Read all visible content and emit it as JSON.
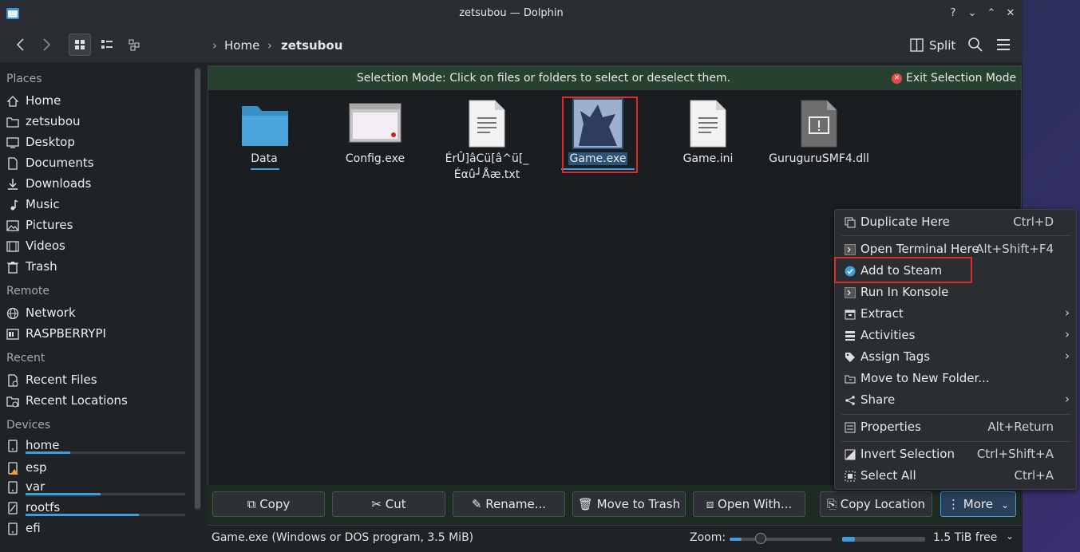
{
  "window": {
    "title": "zetsubou — Dolphin"
  },
  "title_buttons": [
    "?",
    "⌄",
    "⌃",
    "✕"
  ],
  "breadcrumb": {
    "home": "Home",
    "current": "zetsubou"
  },
  "toolbar": {
    "split_label": "Split"
  },
  "sidebar": {
    "places_heading": "Places",
    "places": [
      "Home",
      "zetsubou",
      "Desktop",
      "Documents",
      "Downloads",
      "Music",
      "Pictures",
      "Videos",
      "Trash"
    ],
    "remote_heading": "Remote",
    "remote": [
      "Network",
      "RASPBERRYPI"
    ],
    "recent_heading": "Recent",
    "recent": [
      "Recent Files",
      "Recent Locations"
    ],
    "devices_heading": "Devices",
    "devices": [
      {
        "label": "home",
        "usage": 0.28
      },
      {
        "label": "esp",
        "usage": 0.0
      },
      {
        "label": "var",
        "usage": 0.47
      },
      {
        "label": "rootfs",
        "usage": 0.71
      },
      {
        "label": "efi",
        "usage": 0.0
      }
    ]
  },
  "selection_bar": {
    "message": "Selection Mode: Click on files or folders to select or deselect them.",
    "exit_label": "Exit Selection Mode"
  },
  "files": [
    {
      "name": "Data",
      "icon": "folder-icon"
    },
    {
      "name": "Config.exe",
      "icon": "window-exe-icon"
    },
    {
      "name_line1": "ÉrÛ]âCü[â^ü[_",
      "name_line2": "Éαû┘Åæ.txt",
      "icon": "text-file-icon"
    },
    {
      "name": "Game.exe",
      "icon": "game-exe-icon",
      "selected": true
    },
    {
      "name": "Game.ini",
      "icon": "text-file-icon"
    },
    {
      "name": "GuruguruSMF4.dll",
      "icon": "dll-file-icon"
    }
  ],
  "actions": {
    "copy": "Copy",
    "cut": "Cut",
    "rename": "Rename...",
    "trash": "Move to Trash",
    "open_with": "Open With...",
    "copy_location": "Copy Location",
    "more": "More"
  },
  "context_menu": {
    "duplicate": {
      "label": "Duplicate Here",
      "shortcut": "Ctrl+D"
    },
    "open_terminal": {
      "label": "Open Terminal Here",
      "shortcut": "Alt+Shift+F4"
    },
    "add_to_steam": {
      "label": "Add to Steam"
    },
    "run_konsole": {
      "label": "Run In Konsole"
    },
    "extract": {
      "label": "Extract"
    },
    "activities": {
      "label": "Activities"
    },
    "assign_tags": {
      "label": "Assign Tags"
    },
    "move_new_folder": {
      "label": "Move to New Folder..."
    },
    "share": {
      "label": "Share"
    },
    "properties": {
      "label": "Properties",
      "shortcut": "Alt+Return"
    },
    "invert_selection": {
      "label": "Invert Selection",
      "shortcut": "Ctrl+Shift+A"
    },
    "select_all": {
      "label": "Select All",
      "shortcut": "Ctrl+A"
    }
  },
  "status": {
    "text": "Game.exe (Windows or DOS program, 3.5 MiB)",
    "zoom_label": "Zoom:",
    "zoom_level": 0.12,
    "free_space": "1.5 TiB free",
    "free_usage": 0.15
  },
  "colors": {
    "accent": "#3d9ee0",
    "selection_bar": "#28402f",
    "highlight_box": "#e02b2b"
  }
}
